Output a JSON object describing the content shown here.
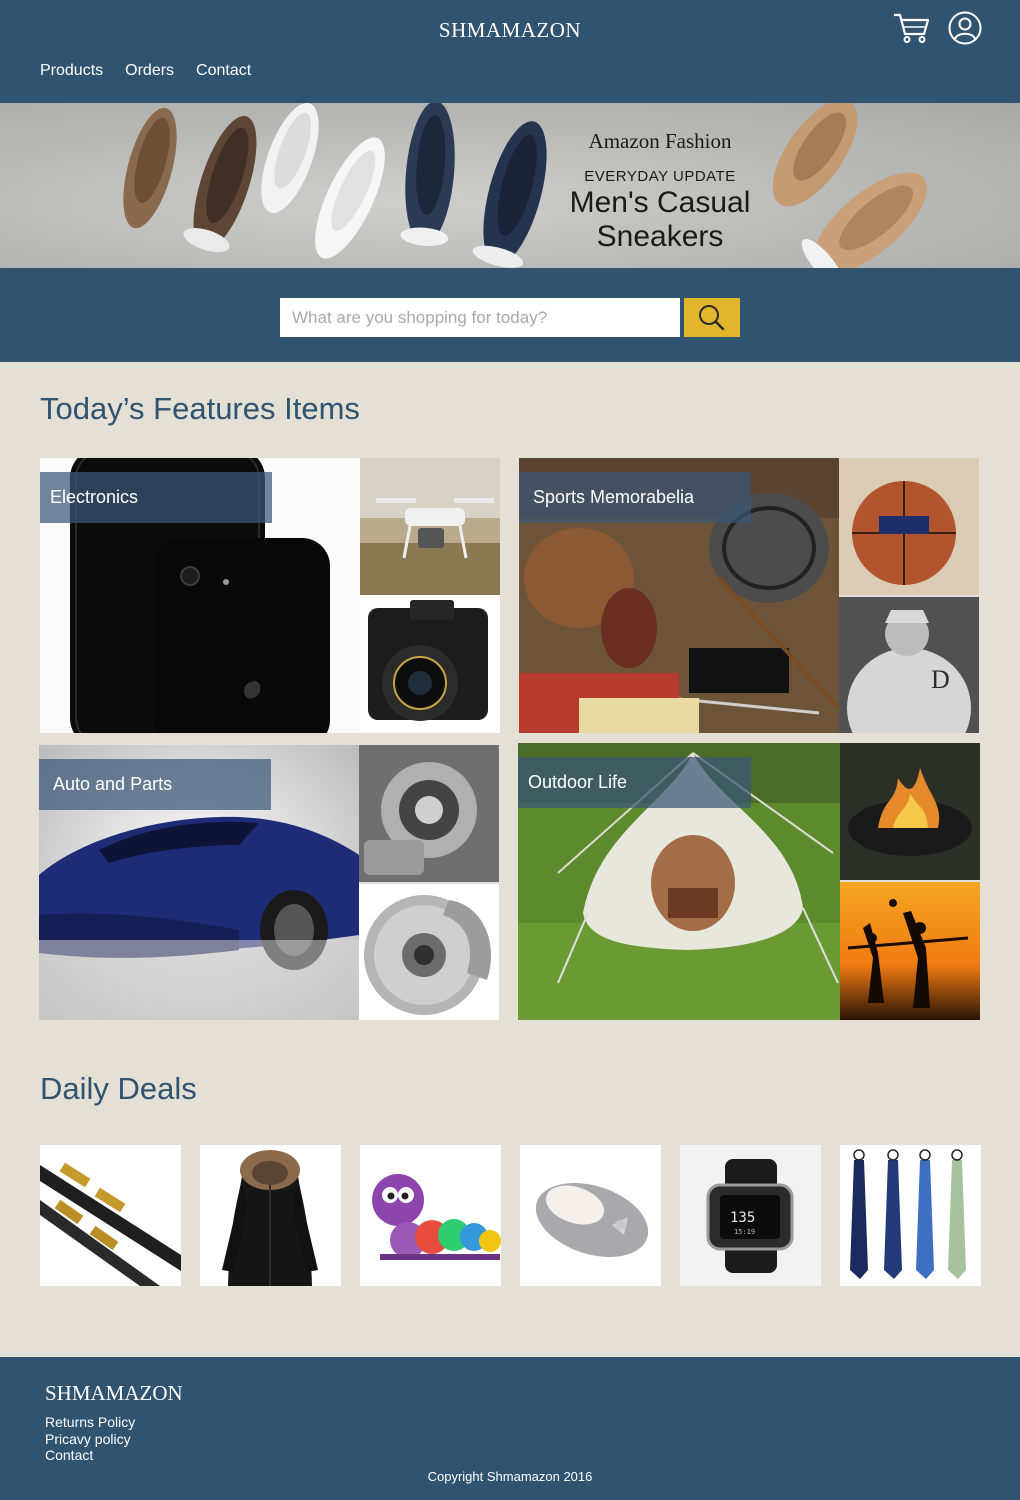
{
  "header": {
    "brand": "SHMAMAZON",
    "nav": [
      "Products",
      "Orders",
      "Contact"
    ],
    "icons": [
      "cart-icon",
      "user-icon"
    ]
  },
  "banner": {
    "line1": "Amazon Fashion",
    "line2": "EVERYDAY UPDATE",
    "line3": "Men's Casual",
    "line4": "Sneakers"
  },
  "search": {
    "placeholder": "What are you shopping for today?",
    "button_icon": "search-icon",
    "button_color": "#e2b52d"
  },
  "featured": {
    "title": "Today’s Features Items",
    "tiles": [
      {
        "label": "Electronics"
      },
      {
        "label": "Sports Memorabelia"
      },
      {
        "label": "Auto and Parts"
      },
      {
        "label": "Outdoor Life"
      }
    ]
  },
  "deals": {
    "title": "Daily Deals",
    "items": [
      "skis",
      "black-parka",
      "toy-caterpillar",
      "slipper",
      "fitness-watch",
      "neckties"
    ]
  },
  "footer": {
    "brand": "SHMAMAZON",
    "links": [
      "Returns Policy",
      "Pricavy policy",
      "Contact"
    ],
    "copyright": "Copyright Shmamazon 2016"
  },
  "colors": {
    "primary": "#30536f",
    "background": "#e4e0d6",
    "accent": "#e2b52d"
  }
}
